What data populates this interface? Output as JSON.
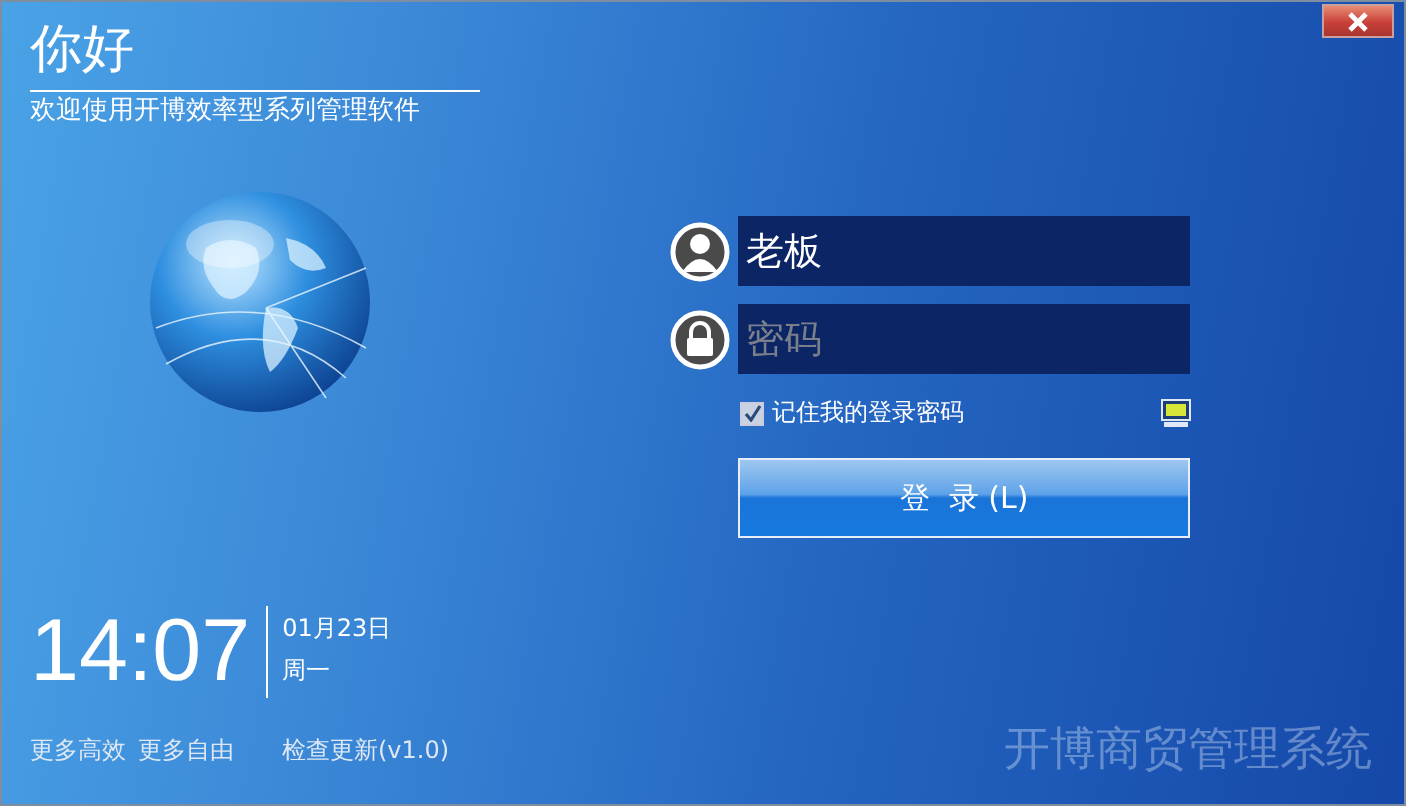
{
  "header": {
    "title": "你好",
    "subtitle": "欢迎使用开博效率型系列管理软件"
  },
  "login": {
    "username": {
      "value": "老板"
    },
    "password": {
      "placeholder": "密码"
    },
    "remember": {
      "label": "记住我的登录密码",
      "checked": true
    },
    "button": "登  录 (L)"
  },
  "clock": {
    "time": "14:07",
    "date": "01月23日",
    "weekday": "周一"
  },
  "footer": {
    "links": [
      "更多高效",
      "更多自由"
    ],
    "update": "检查更新(v1.0)"
  },
  "brand": "开博商贸管理系统"
}
